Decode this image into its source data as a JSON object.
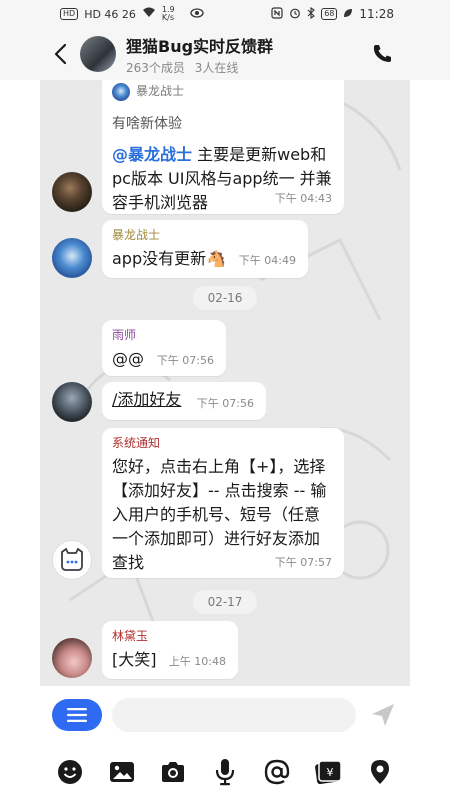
{
  "statusbar": {
    "left_text": "HD 46 26",
    "speed": "1.9 K/s",
    "battery": "68",
    "time": "11:28"
  },
  "header": {
    "title": "狸猫Bug实时反馈群",
    "members": "263个成员",
    "online": "3人在线"
  },
  "messages": [
    {
      "quote_name": "暴龙战士",
      "quote_text": "有啥新体验",
      "mention": "@暴龙战士",
      "text": "主要是更新web和pc版本 UI风格与app统一 并兼容手机浏览器",
      "time": "下午 04:43"
    },
    {
      "sender": "暴龙战士",
      "text": "app没有更新🐴",
      "time": "下午 04:49"
    },
    {
      "sender": "雨师",
      "text": "@@",
      "time": "下午 07:56"
    },
    {
      "text": "/添加好友",
      "time": "下午 07:56"
    },
    {
      "sender": "系统通知",
      "text": "您好，点击右上角【+】，选择【添加好友】-- 点击搜索 -- 输入用户的手机号、短号（任意一个添加即可）进行好友添加查找",
      "time": "下午 07:57"
    },
    {
      "sender": "林黛玉",
      "text": "[大笑]",
      "time": "上午 10:48"
    }
  ],
  "dates": [
    "02-16",
    "02-17"
  ],
  "input": {
    "placeholder": ""
  },
  "colors": {
    "accent": "#2e6bf2",
    "chat_bg": "#e9e9e9",
    "sender_baolong": "#a08a3a",
    "sender_yushi": "#8a4aa0",
    "sender_system": "#b03030",
    "sender_lin": "#b03030"
  }
}
